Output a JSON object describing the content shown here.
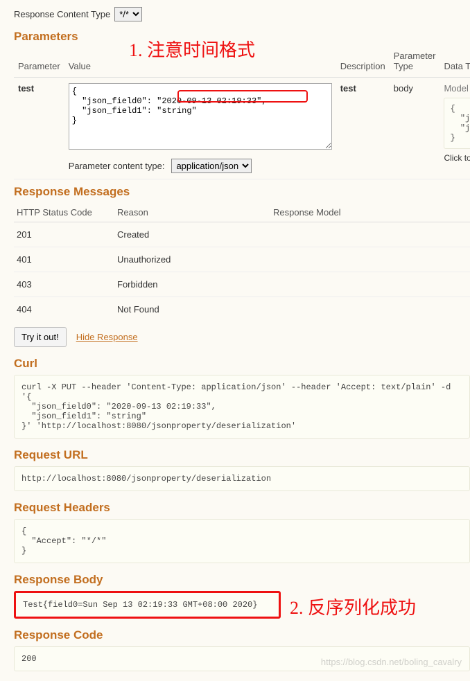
{
  "top": {
    "response_content_type_label": "Response Content Type",
    "response_content_type_value": "*/*"
  },
  "annotations": {
    "a1": "1. 注意时间格式",
    "a2": "2. 反序列化成功"
  },
  "sections": {
    "parameters": "Parameters",
    "response_messages": "Response Messages",
    "curl": "Curl",
    "request_url": "Request URL",
    "request_headers": "Request Headers",
    "response_body": "Response Body",
    "response_code": "Response Code"
  },
  "param_headers": {
    "parameter": "Parameter",
    "value": "Value",
    "description": "Description",
    "parameter_type": "Parameter Type",
    "data_type": "Data T"
  },
  "param_row": {
    "name": "test",
    "value": "{\n  \"json_field0\": \"2020-09-13 02:19:33\",\n  \"json_field1\": \"string\"\n}",
    "description": "test",
    "param_type": "body",
    "data_type_label": "Model",
    "model": "{\n  \"j\n  \"j\n}",
    "model_hint": "Click to",
    "content_type_label": "Parameter content type:",
    "content_type_value": "application/json"
  },
  "resp_headers": {
    "code": "HTTP Status Code",
    "reason": "Reason",
    "model": "Response Model"
  },
  "resp_rows": [
    {
      "code": "201",
      "reason": "Created"
    },
    {
      "code": "401",
      "reason": "Unauthorized"
    },
    {
      "code": "403",
      "reason": "Forbidden"
    },
    {
      "code": "404",
      "reason": "Not Found"
    }
  ],
  "actions": {
    "try": "Try it out!",
    "hide": "Hide Response"
  },
  "curl": "curl -X PUT --header 'Content-Type: application/json' --header 'Accept: text/plain' -d '{\n  \"json_field0\": \"2020-09-13 02:19:33\",\n  \"json_field1\": \"string\"\n}' 'http://localhost:8080/jsonproperty/deserialization'",
  "request_url": "http://localhost:8080/jsonproperty/deserialization",
  "request_headers": "{\n  \"Accept\": \"*/*\"\n}",
  "response_body": "Test{field0=Sun Sep 13 02:19:33 GMT+08:00 2020}",
  "response_code": "200",
  "watermark": "https://blog.csdn.net/boling_cavalry"
}
